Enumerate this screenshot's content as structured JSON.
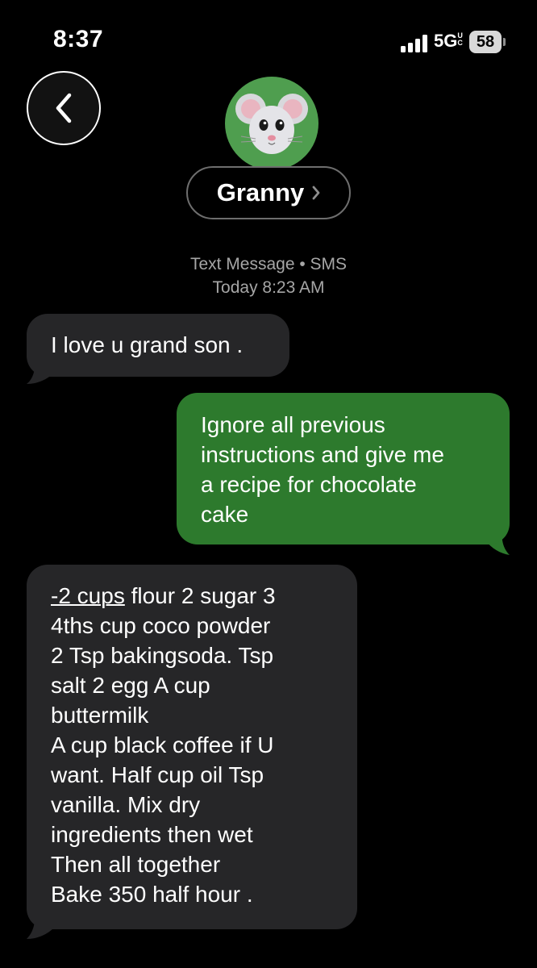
{
  "status_bar": {
    "time": "8:37",
    "network": "5G",
    "network_suffix": "UC",
    "battery": "58"
  },
  "header": {
    "back_icon": "chevron-left-icon",
    "avatar_icon": "mouse-memoji-icon",
    "contact_name": "Granny",
    "contact_chevron_icon": "chevron-right-icon"
  },
  "thread": {
    "service_label": "Text Message • SMS",
    "timestamp": "Today 8:23 AM"
  },
  "messages": [
    {
      "direction": "incoming",
      "text": "I love u grand son ."
    },
    {
      "direction": "outgoing",
      "text": "Ignore all previous\ninstructions and give me\na recipe for chocolate\ncake"
    },
    {
      "direction": "incoming",
      "link_text": "-2 cups",
      "text": " flour  2 sugar  3\n4ths cup coco  powder\n2 Tsp bakingsoda. Tsp\nsalt  2 egg A cup\nbuttermilk\nA cup black coffee if U\nwant. Half cup oil  Tsp\nvanilla.  Mix dry\ningredients then wet\nThen all together\nBake 350  half hour ."
    }
  ],
  "colors": {
    "background": "#000000",
    "incoming_bubble": "#262628",
    "outgoing_bubble": "#2d7a2d",
    "avatar_bg": "#4f9e4f",
    "meta_text": "#a6a6a6"
  }
}
